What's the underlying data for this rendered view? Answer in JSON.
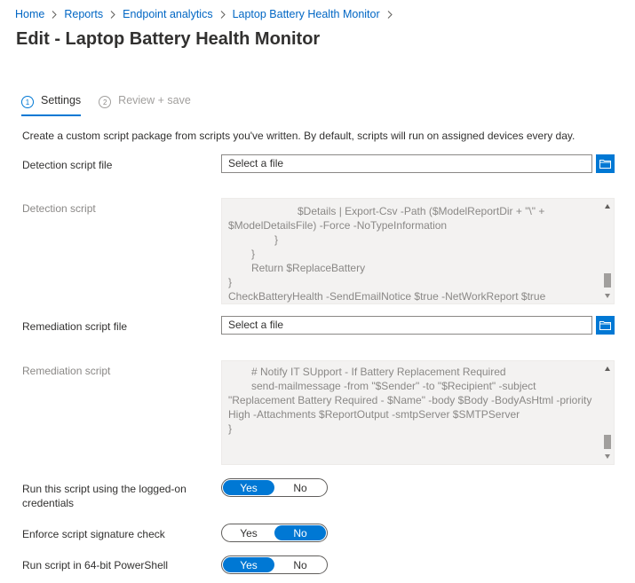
{
  "breadcrumb": [
    "Home",
    "Reports",
    "Endpoint analytics",
    "Laptop Battery Health Monitor"
  ],
  "title": "Edit - Laptop Battery Health Monitor",
  "steps": [
    {
      "num": "1",
      "label": "Settings"
    },
    {
      "num": "2",
      "label": "Review + save"
    }
  ],
  "intro": "Create a custom script package from scripts you've written. By default, scripts will run on assigned devices every day.",
  "detection": {
    "file_label": "Detection script file",
    "file_placeholder": "Select a file",
    "script_label": "Detection script",
    "lines": [
      "$Details | Export-Csv -Path ($ModelReportDir + \"\\\" +",
      "$ModelDetailsFile) -Force -NoTypeInformation",
      "}",
      "}",
      "Return $ReplaceBattery",
      "}",
      "CheckBatteryHealth -SendEmailNotice $true -NetWorkReport $true"
    ]
  },
  "remediation": {
    "file_label": "Remediation script file",
    "file_placeholder": "Select a file",
    "script_label": "Remediation script",
    "lines": [
      "# Notify IT SUpport - If Battery Replacement Required",
      "send-mailmessage -from \"$Sender\" -to \"$Recipient\" -subject",
      "\"Replacement Battery Required - $Name\" -body $Body -BodyAsHtml -priority",
      "High -Attachments $ReportOutput -smtpServer $SMTPServer",
      "}"
    ]
  },
  "options": [
    {
      "label_line1": "Run this script using the logged-on",
      "label_line2": "credentials",
      "yes": "Yes",
      "no": "No",
      "selected": "Yes"
    },
    {
      "label_line1": "Enforce script signature check",
      "label_line2": "",
      "yes": "Yes",
      "no": "No",
      "selected": "No"
    },
    {
      "label_line1": "Run script in 64-bit PowerShell",
      "label_line2": "",
      "yes": "Yes",
      "no": "No",
      "selected": "Yes"
    }
  ],
  "colors": {
    "accent": "#0078d4",
    "link": "#0066c4",
    "code_bg": "#f3f2f1"
  },
  "icons": {
    "breadcrumb_separator": "chevron-right-icon",
    "browse": "folder-icon"
  }
}
